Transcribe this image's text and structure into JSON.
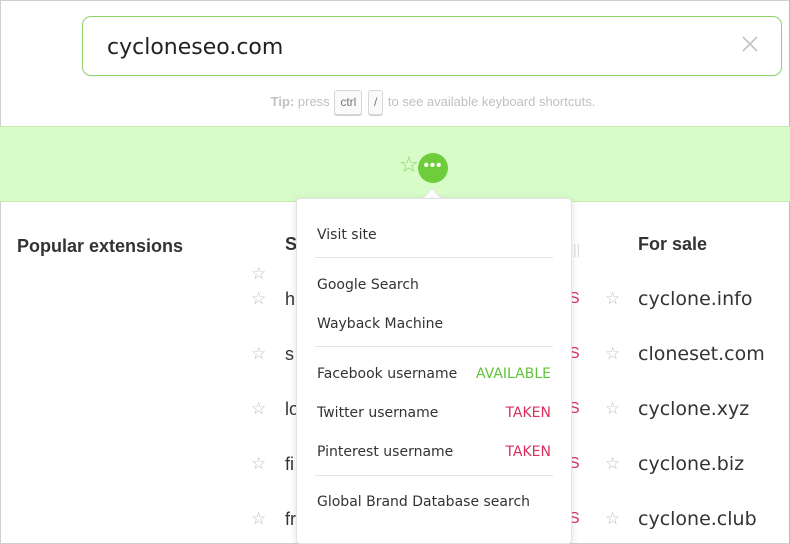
{
  "search": {
    "value": "cycloneseo.com"
  },
  "tip": {
    "label": "Tip:",
    "before": "press",
    "key1": "ctrl",
    "key2": "/",
    "after": "to see available keyboard shortcuts."
  },
  "band": {
    "star": "☆",
    "more": "•••"
  },
  "headings": {
    "popular": "Popular extensions",
    "s": "S",
    "forsale": "For sale"
  },
  "left_rows": [
    {
      "text": "h",
      "status": "S"
    },
    {
      "text": "s",
      "status": "S"
    },
    {
      "text": "lo",
      "status": "S"
    },
    {
      "text": "fi",
      "status": "S"
    },
    {
      "text": "fr",
      "status": "S"
    }
  ],
  "for_sale": [
    "cyclone.info",
    "cloneset.com",
    "cyclone.xyz",
    "cyclone.biz",
    "cyclone.club"
  ],
  "menu": {
    "visit": "Visit site",
    "google": "Google Search",
    "wayback": "Wayback Machine",
    "facebook": {
      "label": "Facebook username",
      "status": "AVAILABLE"
    },
    "twitter": {
      "label": "Twitter username",
      "status": "TAKEN"
    },
    "pinterest": {
      "label": "Pinterest username",
      "status": "TAKEN"
    },
    "global": "Global Brand Database search"
  },
  "colors": {
    "accent": "#6fcc3b",
    "band": "#d8fcc8",
    "taken": "#d9305f",
    "available": "#62c33a"
  }
}
